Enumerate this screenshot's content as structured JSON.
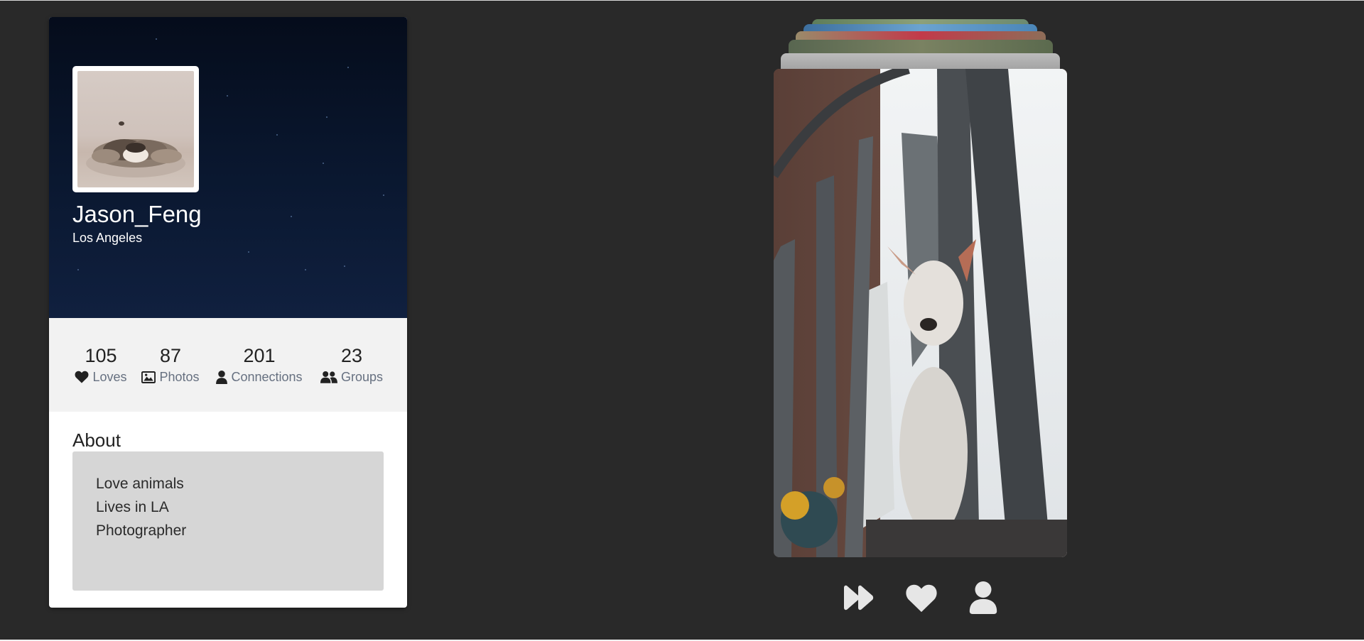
{
  "profile": {
    "username": "Jason_Feng",
    "location": "Los Angeles",
    "stats": [
      {
        "count": "105",
        "label": "Loves",
        "icon": "heart-icon"
      },
      {
        "count": "87",
        "label": "Photos",
        "icon": "image-icon"
      },
      {
        "count": "201",
        "label": "Connections",
        "icon": "user-icon"
      },
      {
        "count": "23",
        "label": "Groups",
        "icon": "users-icon"
      }
    ],
    "about": {
      "title": "About",
      "lines": [
        "Love animals",
        "Lives in LA",
        "Photographer"
      ]
    }
  },
  "actions": {
    "skip_icon": "fast-forward-icon",
    "like_icon": "heart-icon",
    "profile_icon": "user-icon"
  },
  "colors": {
    "page_background": "#292929",
    "cover_top": "#050c1b",
    "cover_bottom": "#10203f",
    "stats_background": "#f2f2f2",
    "about_box": "#d6d6d6",
    "stat_label": "#667080",
    "action_icon": "#e6e6e6"
  }
}
